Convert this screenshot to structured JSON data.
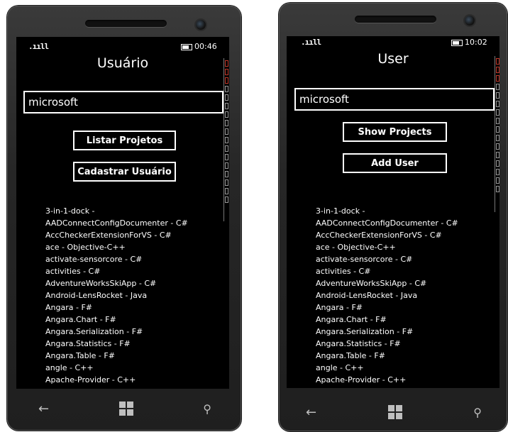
{
  "left_phone": {
    "status": {
      "signal": ".ııll",
      "time": "00:46"
    },
    "title": "Usuário",
    "search_value": "microsoft",
    "buttons": {
      "primary": "Listar Projetos",
      "secondary": "Cadastrar Usuário"
    },
    "projects": [
      "3-in-1-dock -",
      "AADConnectConfigDocumenter - C#",
      "AccCheckerExtensionForVS - C#",
      "ace - Objective-C++",
      "activate-sensorcore - C#",
      "activities - C#",
      "AdventureWorksSkiApp - C#",
      "Android-LensRocket - Java",
      "Angara - F#",
      "Angara.Chart - F#",
      "Angara.Serialization - F#",
      "Angara.Statistics - F#",
      "Angara.Table - F#",
      "angle - C++",
      "Apache-Provider - C++"
    ]
  },
  "right_phone": {
    "status": {
      "signal": ".ııll",
      "time": "10:02"
    },
    "title": "User",
    "search_value": "microsoft",
    "buttons": {
      "primary": "Show Projects",
      "secondary": "Add User"
    },
    "projects": [
      "3-in-1-dock -",
      "AADConnectConfigDocumenter - C#",
      "AccCheckerExtensionForVS - C#",
      "ace - Objective-C++",
      "activate-sensorcore - C#",
      "activities - C#",
      "AdventureWorksSkiApp - C#",
      "Android-LensRocket - Java",
      "Angara - F#",
      "Angara.Chart - F#",
      "Angara.Serialization - F#",
      "Angara.Statistics - F#",
      "Angara.Table - F#",
      "angle - C++",
      "Apache-Provider - C++"
    ]
  },
  "nav_icons": [
    "back-arrow-icon",
    "windows-start-icon",
    "search-icon"
  ],
  "colors": {
    "screen": "#000000",
    "text": "#ffffff",
    "bezel": "#2a2a2a",
    "nav_icon": "#bfbfbf"
  }
}
